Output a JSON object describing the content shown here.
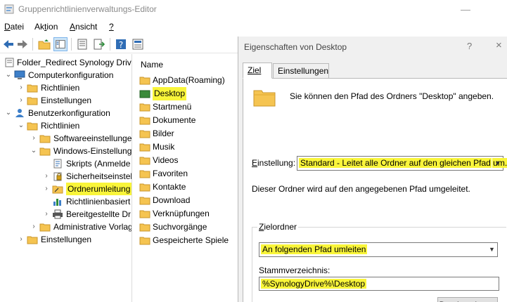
{
  "main_window": {
    "title": "Gruppenrichtlinienverwaltungs-Editor",
    "minimize": "—",
    "menu": [
      {
        "label": "Datei",
        "accel": "D",
        "rest": "atei"
      },
      {
        "pre": "Ak",
        "accel": "t",
        "rest": "ion"
      },
      {
        "label": "Ansicht",
        "accel": "A",
        "rest": "nsicht"
      },
      {
        "label": "?",
        "accel": "?",
        "rest": ""
      }
    ]
  },
  "tree": {
    "items": [
      {
        "label": "Folder_Redirect Synology Drive",
        "chev": "",
        "icon": "policy-doc-icon"
      },
      {
        "label": "Computerkonfiguration",
        "chev": "⌄",
        "icon": "computer-icon"
      },
      {
        "label": "Richtlinien",
        "chev": "›",
        "icon": "folder-icon"
      },
      {
        "label": "Einstellungen",
        "chev": "›",
        "icon": "folder-icon"
      },
      {
        "label": "Benutzerkonfiguration",
        "chev": "⌄",
        "icon": "user-icon"
      },
      {
        "label": "Richtlinien",
        "chev": "⌄",
        "icon": "folder-icon"
      },
      {
        "label": "Softwareeinstellunge",
        "chev": "›",
        "icon": "folder-icon"
      },
      {
        "label": "Windows-Einstellung",
        "chev": "⌄",
        "icon": "folder-icon"
      },
      {
        "label": "Skripts (Anmelde",
        "chev": "",
        "icon": "script-icon"
      },
      {
        "label": "Sicherheitseinstel",
        "chev": "›",
        "icon": "security-icon"
      },
      {
        "label": "Ordnerumleitung",
        "chev": "›",
        "icon": "folder-redirect-icon"
      },
      {
        "label": "Richtlinienbasiert",
        "chev": "",
        "icon": "chart-icon"
      },
      {
        "label": "Bereitgestellte Dr",
        "chev": "›",
        "icon": "printer-icon"
      },
      {
        "label": "Administrative Vorlag",
        "chev": "›",
        "icon": "folder-icon"
      },
      {
        "label": "Einstellungen",
        "chev": "›",
        "icon": "folder-icon"
      }
    ]
  },
  "list": {
    "header": "Name",
    "items": [
      "AppData(Roaming)",
      "Desktop",
      "Startmenü",
      "Dokumente",
      "Bilder",
      "Musik",
      "Videos",
      "Favoriten",
      "Kontakte",
      "Download",
      "Verknüpfungen",
      "Suchvorgänge",
      "Gespeicherte Spiele"
    ]
  },
  "dialog": {
    "title": "Eigenschaften von Desktop",
    "help": "?",
    "close": "×",
    "tabs": [
      "Ziel",
      "Einstellungen"
    ],
    "description": "Sie können den Pfad des Ordners \"Desktop\" angeben.",
    "setting_label": "Einstellung:",
    "setting_value": "Standard - Leitet alle Ordner auf den gleichen Pfad um.",
    "info": "Dieser Ordner wird auf den angegebenen Pfad umgeleitet.",
    "target_group": "Zielordner",
    "target_value": "An folgenden Pfad umleiten",
    "root_label": "Stammverzeichnis:",
    "root_value": "%SynologyDrive%\\Desktop",
    "browse_button": "Durchsuchen..."
  },
  "colors": {
    "highlight": "#f9f53a",
    "folder": "#f5c451"
  }
}
